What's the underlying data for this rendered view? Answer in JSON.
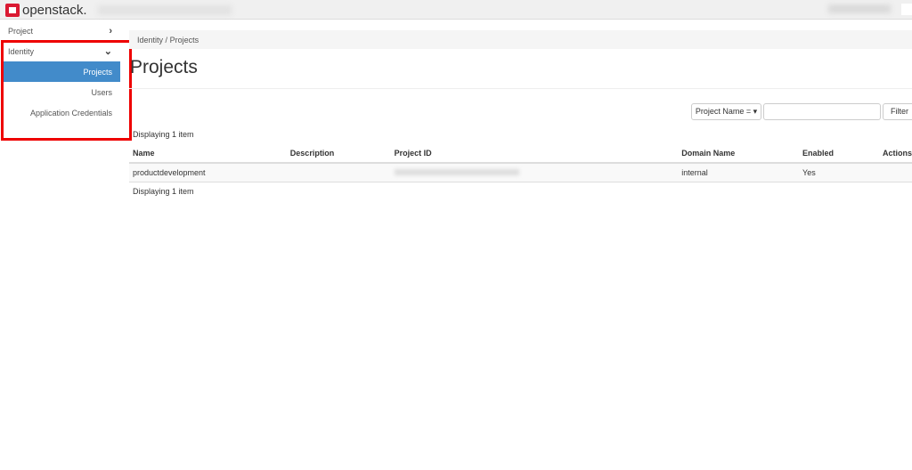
{
  "header": {
    "brand": "openstack."
  },
  "sidebar": {
    "project": "Project",
    "identity": "Identity",
    "items": [
      {
        "label": "Projects"
      },
      {
        "label": "Users"
      },
      {
        "label": "Application Credentials"
      }
    ]
  },
  "breadcrumb": {
    "parent": "Identity",
    "sep": "/",
    "current": "Projects"
  },
  "page": {
    "title": "Projects"
  },
  "filter": {
    "select": "Project Name = ▾",
    "input": "",
    "button": "Filter"
  },
  "table": {
    "count_top": "Displaying 1 item",
    "count_bottom": "Displaying 1 item",
    "headers": [
      "Name",
      "Description",
      "Project ID",
      "Domain Name",
      "Enabled",
      "Actions"
    ],
    "rows": [
      {
        "name": "productdevelopment",
        "description": "",
        "domain": "internal",
        "enabled": "Yes"
      }
    ]
  }
}
